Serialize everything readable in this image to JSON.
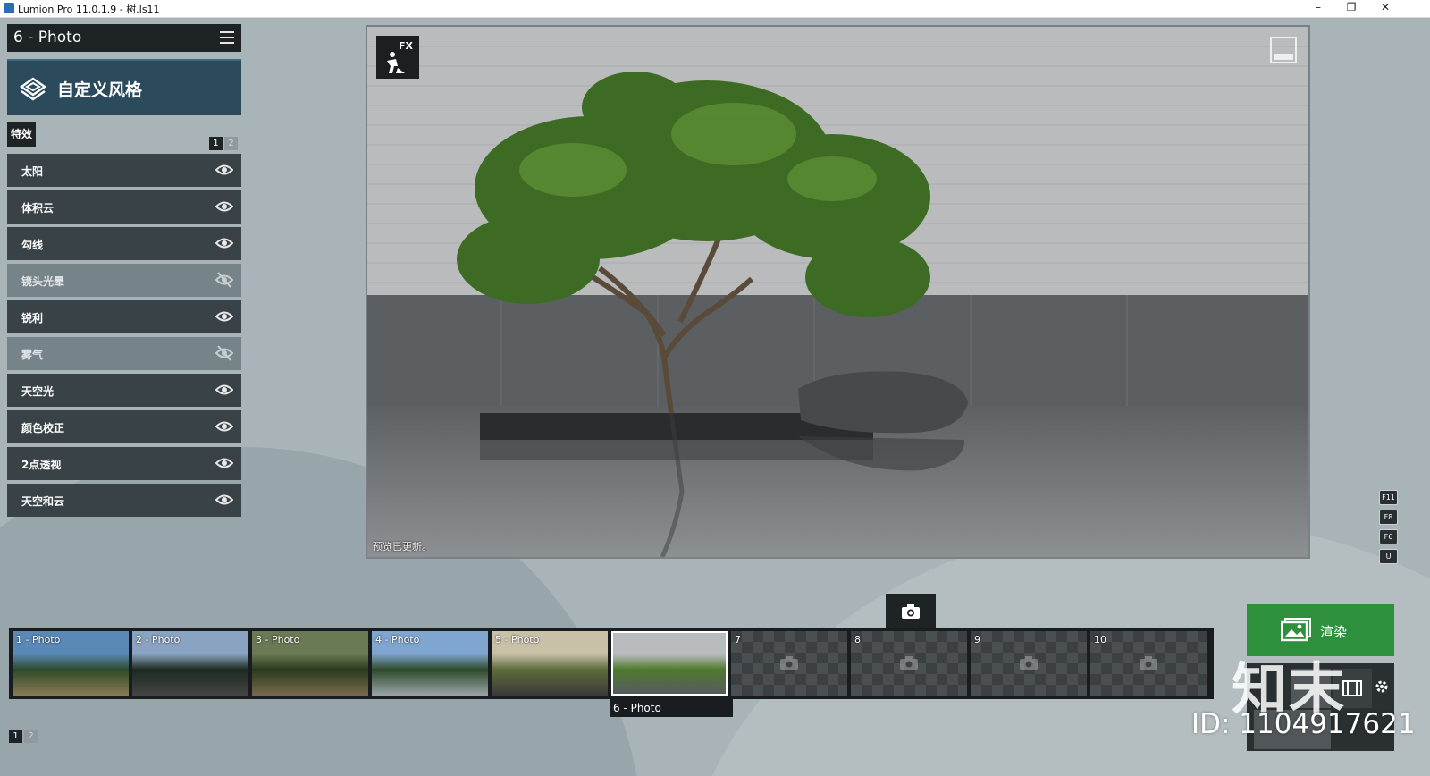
{
  "window": {
    "title": "Lumion Pro 11.0.1.9 - 树.ls11",
    "minimize": "–",
    "maximize": "❐",
    "close": "✕"
  },
  "panel": {
    "photo_title": "6 - Photo",
    "style_label": "自定义风格",
    "fx_tab": "特效",
    "pages": [
      "1",
      "2"
    ],
    "effects": [
      {
        "name": "太阳",
        "visible": true
      },
      {
        "name": "体积云",
        "visible": true
      },
      {
        "name": "勾线",
        "visible": true
      },
      {
        "name": "镜头光晕",
        "visible": false
      },
      {
        "name": "锐利",
        "visible": true
      },
      {
        "name": "雾气",
        "visible": false
      },
      {
        "name": "天空光",
        "visible": true
      },
      {
        "name": "颜色校正",
        "visible": true
      },
      {
        "name": "2点透视",
        "visible": true
      },
      {
        "name": "天空和云",
        "visible": true
      }
    ]
  },
  "viewport": {
    "fx_label": "FX",
    "status": "预览已更新。"
  },
  "fkeys": [
    "F11",
    "F8",
    "F6",
    "U"
  ],
  "filmstrip": {
    "slots": [
      {
        "label": "1 - Photo",
        "filled": true,
        "palette": [
          "#5a89b8",
          "#2e4a2a",
          "#8a7b52"
        ]
      },
      {
        "label": "2 - Photo",
        "filled": true,
        "palette": [
          "#8aa3c2",
          "#1d2a20",
          "#444"
        ]
      },
      {
        "label": "3 - Photo",
        "filled": true,
        "palette": [
          "#6a7a54",
          "#2a3a1e",
          "#7a6a4e"
        ]
      },
      {
        "label": "4 - Photo",
        "filled": true,
        "palette": [
          "#7fa6d0",
          "#2e4a2a",
          "#9aa4a8"
        ]
      },
      {
        "label": "5 - Photo",
        "filled": true,
        "palette": [
          "#c9c0a8",
          "#5c6b3a",
          "#3a3a3a"
        ]
      },
      {
        "label": "",
        "filled": true,
        "selected": true,
        "palette": [
          "#b8bcbf",
          "#4e7a2e",
          "#555b5e"
        ]
      },
      {
        "label": "7",
        "filled": false
      },
      {
        "label": "8",
        "filled": false
      },
      {
        "label": "9",
        "filled": false
      },
      {
        "label": "10",
        "filled": false
      }
    ],
    "selected_caption": "6 - Photo",
    "pages": [
      "1",
      "2"
    ]
  },
  "render": {
    "label": "渲染"
  },
  "watermark": {
    "logo": "知末",
    "id": "ID: 1104917621"
  },
  "colors": {
    "panel_dark": "#394247",
    "panel_disabled": "#76848a",
    "banner": "#2b4a5c",
    "render_green": "#2e8f3c"
  }
}
